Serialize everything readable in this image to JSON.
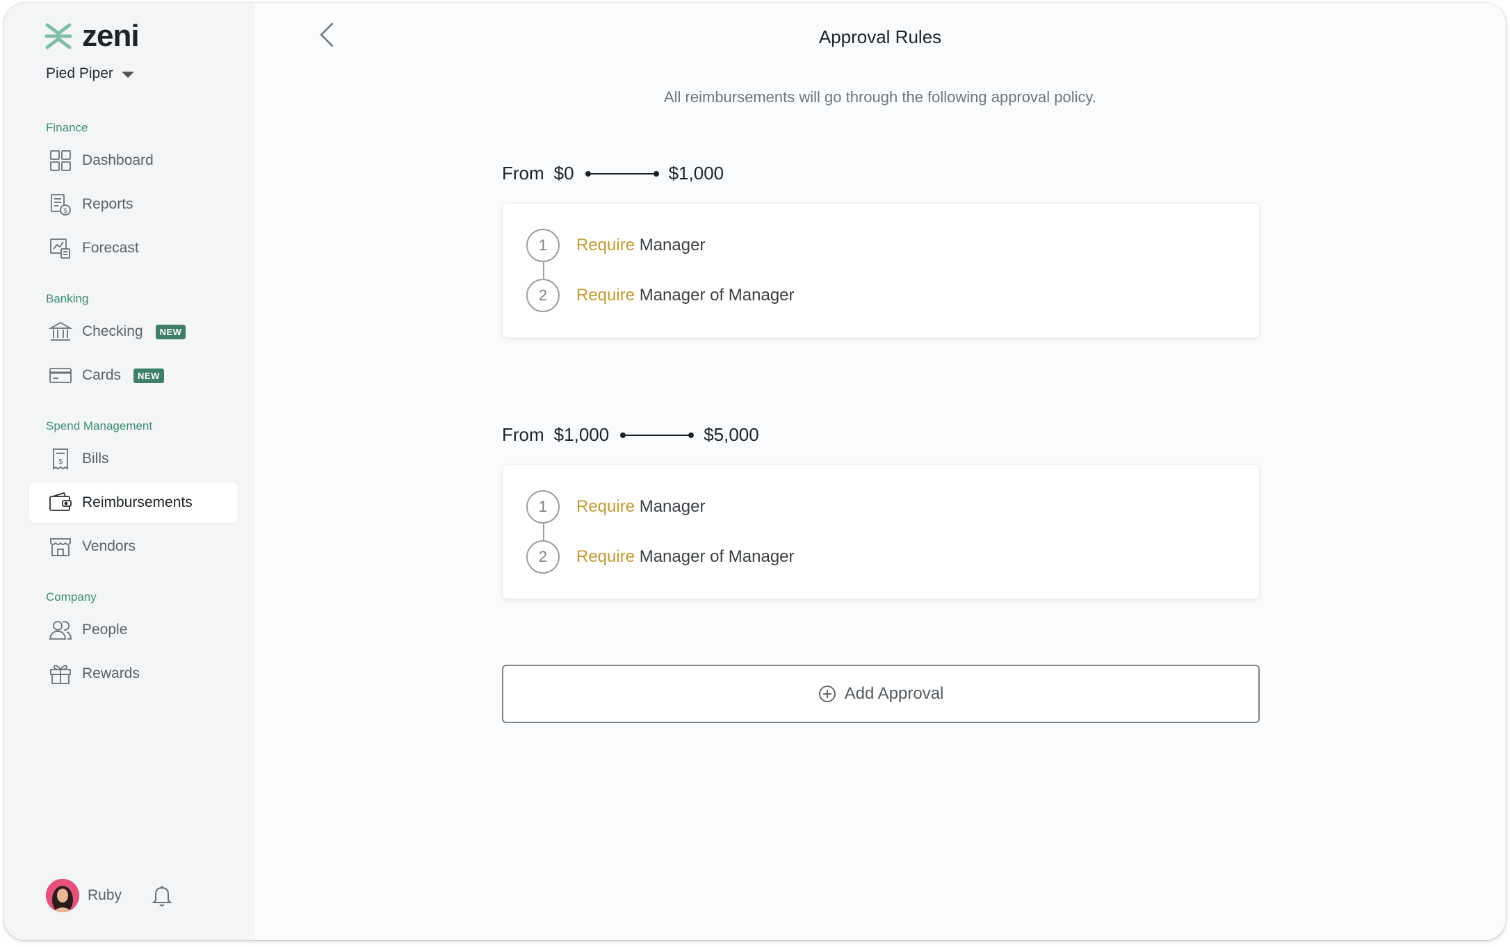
{
  "app": {
    "logo_text": "zeni",
    "org_name": "Pied Piper"
  },
  "sidebar": {
    "sections": [
      {
        "label": "Finance",
        "items": [
          {
            "label": "Dashboard",
            "icon": "dashboard-icon"
          },
          {
            "label": "Reports",
            "icon": "reports-icon"
          },
          {
            "label": "Forecast",
            "icon": "forecast-icon"
          }
        ]
      },
      {
        "label": "Banking",
        "items": [
          {
            "label": "Checking",
            "icon": "bank-icon",
            "badge": "NEW"
          },
          {
            "label": "Cards",
            "icon": "card-icon",
            "badge": "NEW"
          }
        ]
      },
      {
        "label": "Spend Management",
        "items": [
          {
            "label": "Bills",
            "icon": "bill-icon"
          },
          {
            "label": "Reimbursements",
            "icon": "wallet-icon",
            "active": true
          },
          {
            "label": "Vendors",
            "icon": "store-icon"
          }
        ]
      },
      {
        "label": "Company",
        "items": [
          {
            "label": "People",
            "icon": "people-icon"
          },
          {
            "label": "Rewards",
            "icon": "gift-icon"
          }
        ]
      }
    ],
    "user": {
      "name": "Ruby"
    }
  },
  "main": {
    "title": "Approval Rules",
    "subtitle": "All reimbursements will go through the following approval policy.",
    "rules": [
      {
        "from_label": "From",
        "from": "$0",
        "to": "$1,000",
        "steps": [
          {
            "num": "1",
            "action": "Require",
            "approver": "Manager"
          },
          {
            "num": "2",
            "action": "Require",
            "approver": "Manager of Manager"
          }
        ]
      },
      {
        "from_label": "From",
        "from": "$1,000",
        "to": "$5,000",
        "steps": [
          {
            "num": "1",
            "action": "Require",
            "approver": "Manager"
          },
          {
            "num": "2",
            "action": "Require",
            "approver": "Manager of Manager"
          }
        ]
      }
    ],
    "add_button_label": "Add Approval"
  },
  "colors": {
    "accent_green": "#3f8f77",
    "require_gold": "#c99a2e",
    "badge_green": "#3f7f6a"
  }
}
